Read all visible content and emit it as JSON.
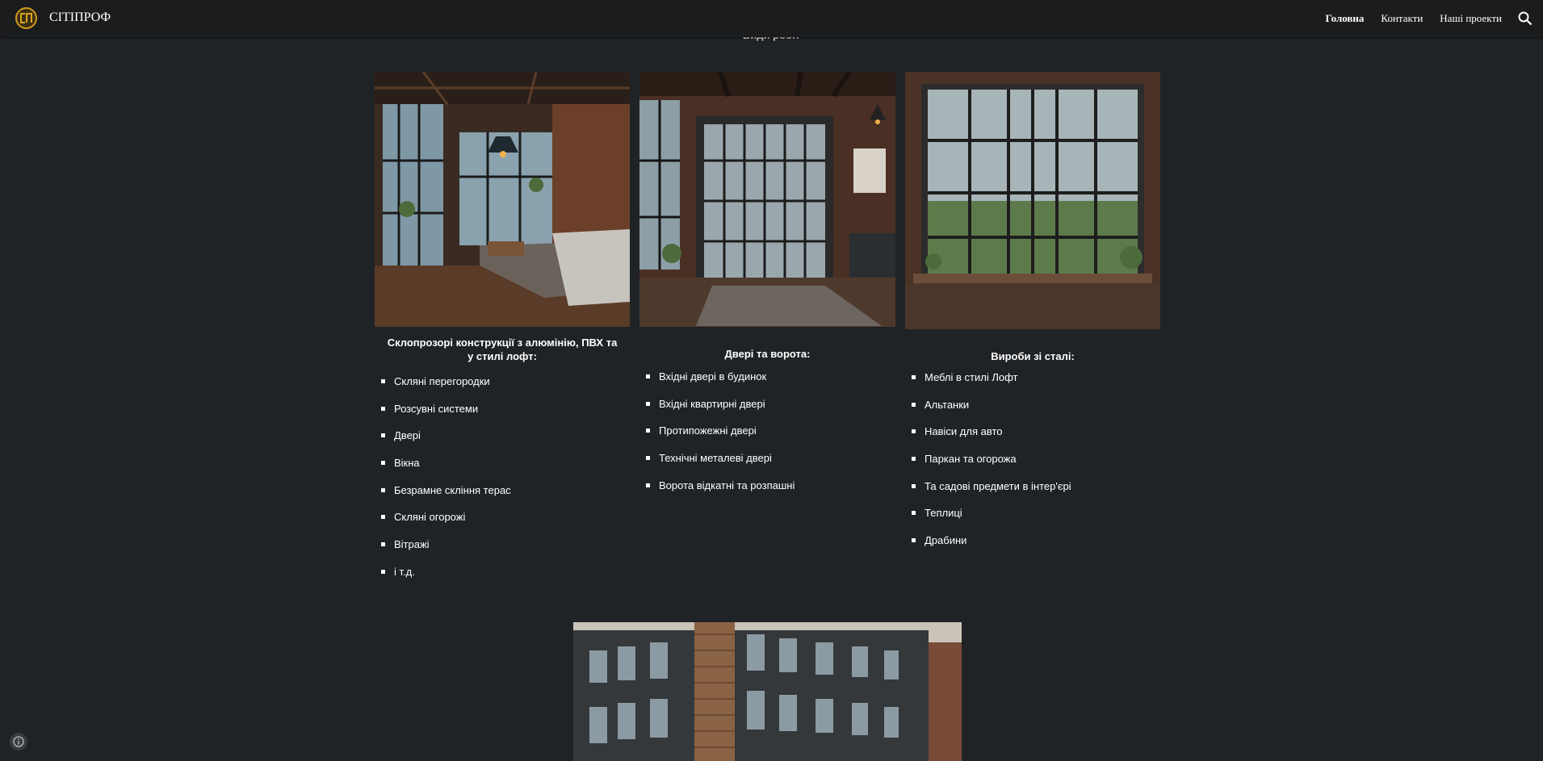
{
  "header": {
    "site_title": "СІТІПРОФ",
    "nav": [
      "Головна",
      "Контакти",
      "Наші проекти"
    ]
  },
  "section_heading": "Види робіт",
  "columns": [
    {
      "title": "Склопрозорі конструкції з алюмінію, ПВХ та у стилі лофт:",
      "items": [
        "Скляні перегородки",
        "Розсувні системи",
        "Двері",
        "Вікна",
        "Безрамне скління терас",
        "Скляні огорожі",
        "Вітражі",
        "і т.д."
      ]
    },
    {
      "title": "Двері та ворота:",
      "items": [
        "Вхідні двері в будинок",
        "Вхідні квартирні двері",
        "Протипожежні двері",
        "Технічні металеві двері",
        "Ворота відкатні та розпашні"
      ]
    },
    {
      "title": "Вироби зі сталі:",
      "items": [
        "Меблі в стилі Лофт",
        "Альтанки",
        "Навіси для авто",
        "Паркан та огорожа",
        "Та садові предмети в інтер'єрі",
        "Теплиці",
        "Драбини"
      ]
    }
  ],
  "icons": {
    "logo": "logo-icon",
    "search": "search-icon",
    "info": "info-icon"
  },
  "colors": {
    "background": "#202326",
    "topbar": "#1a1c1e",
    "accent": "#d79a1a"
  }
}
